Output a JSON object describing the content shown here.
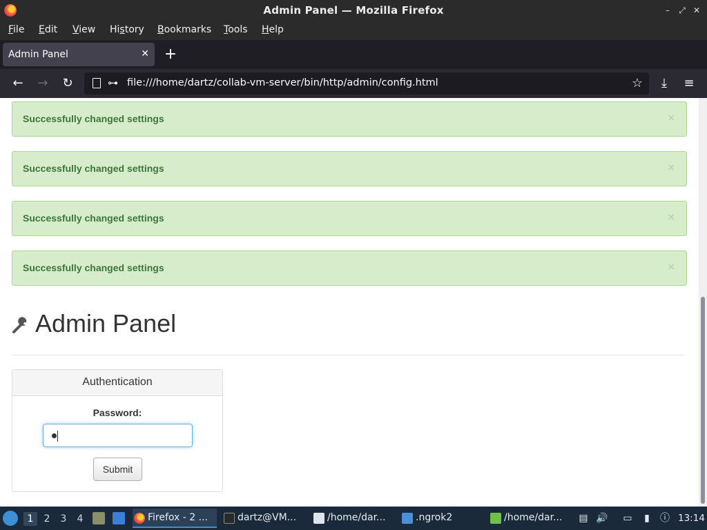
{
  "window": {
    "title": "Admin Panel — Mozilla Firefox",
    "controls": [
      "–",
      "⤢",
      "✕"
    ]
  },
  "menubar": {
    "items": [
      {
        "key": "F",
        "rest": "ile"
      },
      {
        "key": "E",
        "rest": "dit"
      },
      {
        "key": "V",
        "rest": "iew"
      },
      {
        "pre": "Hi",
        "key": "s",
        "rest": "tory"
      },
      {
        "key": "B",
        "rest": "ookmarks"
      },
      {
        "key": "T",
        "rest": "ools"
      },
      {
        "key": "H",
        "rest": "elp"
      }
    ]
  },
  "tabs": [
    {
      "label": "Admin Panel",
      "active": true
    }
  ],
  "newtab_label": "+",
  "navbar": {
    "url": "file:///home/dartz/collab-vm-server/bin/http/admin/config.html"
  },
  "page": {
    "alerts": [
      {
        "text": "Successfully changed settings",
        "close": "×"
      },
      {
        "text": "Successfully changed settings",
        "close": "×"
      },
      {
        "text": "Successfully changed settings",
        "close": "×"
      },
      {
        "text": "Successfully changed settings",
        "close": "×"
      }
    ],
    "heading": "Admin Panel",
    "auth_panel": {
      "title": "Authentication",
      "password_label": "Password:",
      "submit_label": "Submit"
    }
  },
  "taskbar": {
    "workspaces": [
      "1",
      "2",
      "3",
      "4"
    ],
    "active_workspace": "1",
    "tasks": [
      {
        "label": "Firefox - 2 ...",
        "icon": "firefox-icon",
        "active": true
      },
      {
        "label": "dartz@VM...",
        "icon": "terminal-icon",
        "active": false
      },
      {
        "label": "/home/dar...",
        "icon": "text-editor-icon",
        "active": false
      },
      {
        "label": ".ngrok2",
        "icon": "folder-icon",
        "active": false
      },
      {
        "label": "/home/dar...",
        "icon": "file-manager-icon",
        "active": false
      }
    ],
    "clock": "13:14"
  },
  "colors": {
    "alert_bg": "#d7ecca",
    "alert_text": "#3c763d",
    "browser_chrome": "#2b2a33",
    "taskbar_bg": "#1b2a3a"
  }
}
